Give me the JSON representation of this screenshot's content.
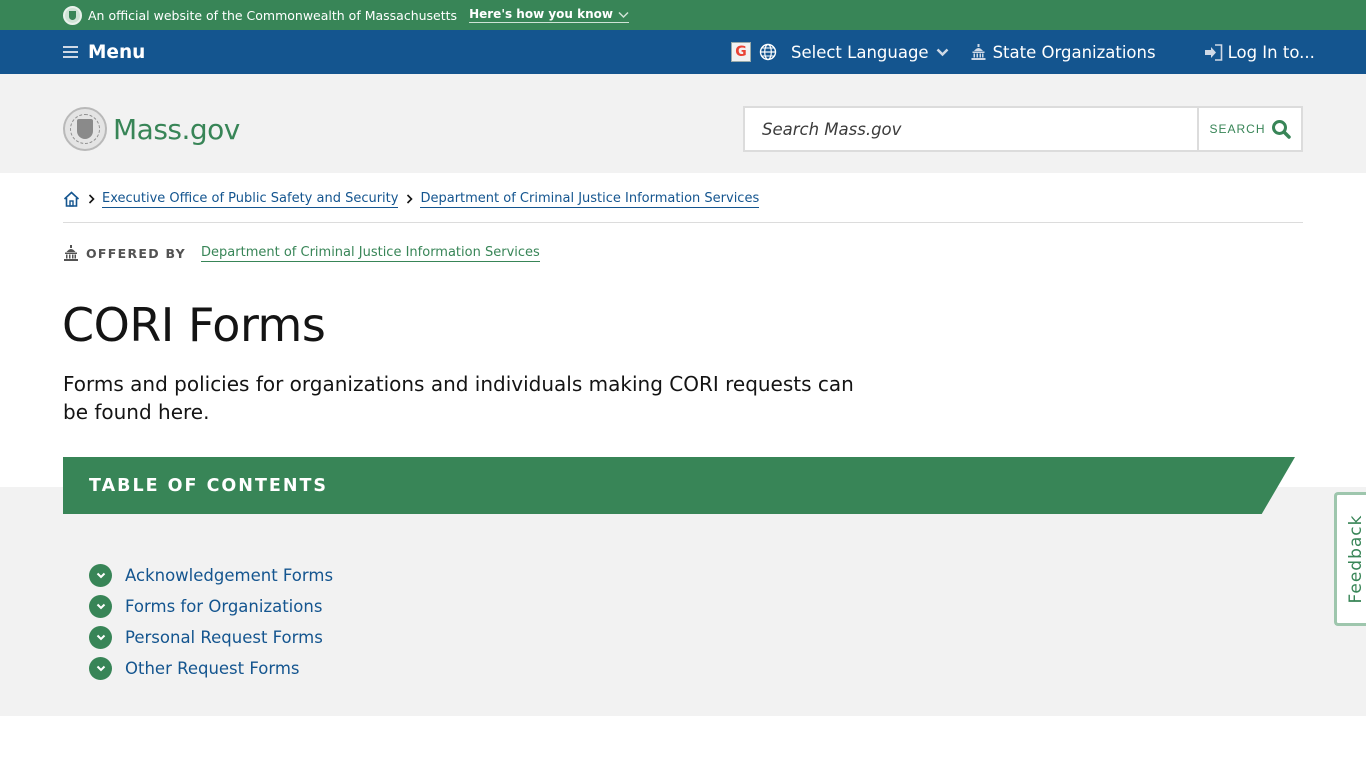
{
  "official_banner": {
    "text": "An official website of the Commonwealth of Massachusetts",
    "how_you_know": "Here's how you know"
  },
  "utility_nav": {
    "menu_label": "Menu",
    "translate_icon": "G",
    "language_label": "Select Language",
    "state_orgs_label": "State Organizations",
    "login_label": "Log In to..."
  },
  "header": {
    "logo_text": "Mass.gov",
    "search_placeholder": "Search Mass.gov",
    "search_button": "SEARCH"
  },
  "breadcrumb": {
    "items": [
      "Executive Office of Public Safety and Security",
      "Department of Criminal Justice Information Services"
    ]
  },
  "offered_by": {
    "label": "OFFERED BY",
    "org": "Department of Criminal Justice Information Services"
  },
  "page": {
    "title": "CORI Forms",
    "lede": "Forms and policies for organizations and individuals making CORI requests can be found here."
  },
  "toc": {
    "heading": "TABLE OF CONTENTS",
    "items": [
      "Acknowledgement Forms",
      "Forms for Organizations",
      "Personal Request Forms",
      "Other Request Forms"
    ]
  },
  "feedback": {
    "label": "Feedback"
  },
  "colors": {
    "brand_green": "#388557",
    "nav_blue": "#14558f",
    "link_blue": "#14558f",
    "header_gray": "#f2f2f2"
  }
}
